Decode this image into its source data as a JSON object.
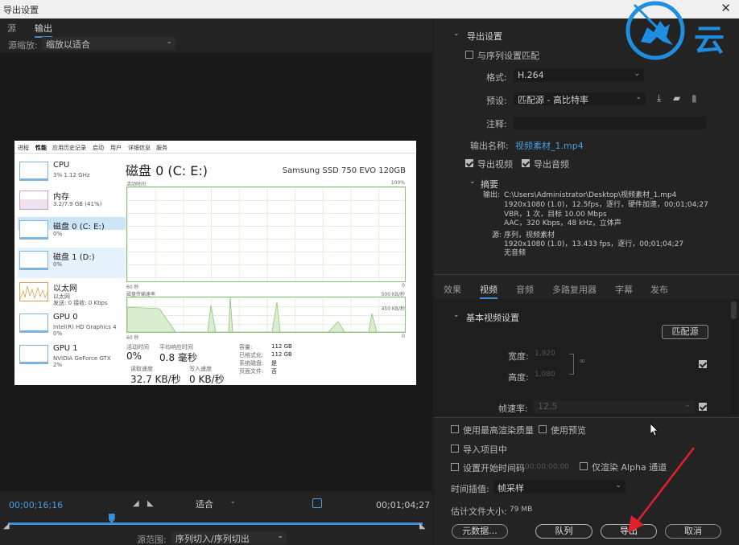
{
  "window": {
    "title": "导出设置"
  },
  "left": {
    "tabs": [
      "源",
      "输出"
    ],
    "active_tab": "输出",
    "zoom_label": "源缩放:",
    "zoom_value": "缩放以适合"
  },
  "taskmgr": {
    "tabs": [
      "进程",
      "性能",
      "应用历史记录",
      "启动",
      "用户",
      "详细信息",
      "服务"
    ],
    "active_tab": "性能",
    "items": [
      {
        "name": "CPU",
        "sub": "3% 1.12 GHz",
        "sub2": ""
      },
      {
        "name": "内存",
        "sub": "3.2/7.9 GB (41%)",
        "sub2": ""
      },
      {
        "name": "磁盘 0 (C: E:)",
        "sub": "0%",
        "sub2": ""
      },
      {
        "name": "磁盘 1 (D:)",
        "sub": "0%",
        "sub2": ""
      },
      {
        "name": "以太网",
        "sub": "以太网",
        "sub2": "发送: 0 接收: 0 Kbps"
      },
      {
        "name": "GPU 0",
        "sub": "Intel(R) HD Graphics 4",
        "sub2": "0%"
      },
      {
        "name": "GPU 1",
        "sub": "NVIDIA GeForce GTX",
        "sub2": "2%"
      }
    ],
    "title": "磁盘 0 (C: E:)",
    "model": "Samsung SSD 750 EVO 120GB",
    "graph1_label": "活动时间",
    "graph1_max": "100%",
    "graph1_time": "60 秒",
    "graph1_min": "0",
    "graph2_label": "磁盘传输速率",
    "graph2_max": "500 KB/秒",
    "graph2_mid": "450 KB/秒",
    "graph2_time": "60 秒",
    "graph2_min": "0",
    "stats": {
      "active_label": "活动时间",
      "active_value": "0%",
      "resp_label": "平均响应时间",
      "resp_value": "0.8 毫秒",
      "read_label": "读取速度",
      "read_value": "32.7 KB/秒",
      "write_label": "写入速度",
      "write_value": "0 KB/秒",
      "cap_label": "容量:",
      "cap_value": "112 GB",
      "fmt_label": "已格式化:",
      "fmt_value": "112 GB",
      "sys_label": "系统磁盘:",
      "sys_value": "是",
      "page_label": "页面文件:",
      "page_value": "否"
    }
  },
  "timeline": {
    "current_tc": "00;00;16;16",
    "end_tc": "00;01;04;27",
    "fit": "适合",
    "range_label": "源范围:",
    "range_value": "序列切入/序列切出",
    "playhead_fraction": 0.25
  },
  "export": {
    "header": "导出设置",
    "match_seq": "与序列设置匹配",
    "format_label": "格式:",
    "format_value": "H.264",
    "preset_label": "预设:",
    "preset_value": "匹配源 - 高比特率",
    "comment_label": "注释:",
    "output_label": "输出名称:",
    "output_value": "视频素材_1.mp4",
    "export_video": "导出视频",
    "export_audio": "导出音频",
    "summary_label": "摘要",
    "summary_output_label": "输出:",
    "summary_output": [
      "C:\\Users\\Administrator\\Desktop\\视频素材_1.mp4",
      "1920x1080 (1.0)，12.5fps，逐行，硬件加速，00;01;04;27",
      "VBR，1 次，目标 10.00 Mbps",
      "AAC，320 Kbps，48 kHz，立体声"
    ],
    "summary_source_label": "源:",
    "summary_source": [
      "序列，视频素材",
      "1920x1080 (1.0)，13.433 fps，逐行，00;01;04;27",
      "无音频"
    ]
  },
  "right_tabs": [
    "效果",
    "视频",
    "音频",
    "多路复用器",
    "字幕",
    "发布"
  ],
  "right_active_tab": "视频",
  "video": {
    "header": "基本视频设置",
    "match_btn": "匹配源",
    "width_label": "宽度:",
    "width_value": "1,920",
    "height_label": "高度:",
    "height_value": "1,080",
    "fps_label": "帧速率:",
    "fps_value": "12.5"
  },
  "bottom": {
    "max_render": "使用最高渲染质量",
    "use_preview": "使用预览",
    "import_project": "导入项目中",
    "set_start_tc": "设置开始时间码",
    "start_tc_value": "00;00;00;00",
    "alpha_only": "仅渲染 Alpha 通道",
    "interp_label": "时间插值:",
    "interp_value": "帧采样",
    "est_size_label": "估计文件大小:",
    "est_size_value": "79 MB",
    "btn_metadata": "元数据...",
    "btn_queue": "队列",
    "btn_export": "导出",
    "btn_cancel": "取消"
  },
  "logo_text": "云",
  "colors": {
    "accent": "#3a8fd6",
    "logo": "#1e8fe0",
    "arrow": "#e0202a"
  }
}
